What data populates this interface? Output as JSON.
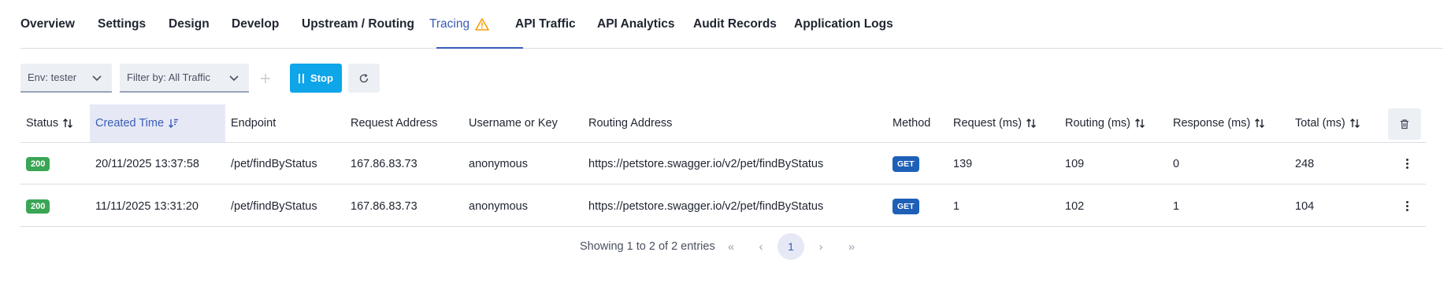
{
  "tabs": [
    {
      "label": "Overview",
      "active": false
    },
    {
      "label": "Settings",
      "active": false
    },
    {
      "label": "Design",
      "active": false
    },
    {
      "label": "Develop",
      "active": false
    },
    {
      "label": "Upstream / Routing",
      "active": false
    },
    {
      "label": "Tracing",
      "active": true,
      "icon": "warning-icon"
    },
    {
      "label": "API Traffic",
      "active": false
    },
    {
      "label": "API Analytics",
      "active": false
    },
    {
      "label": "Audit Records",
      "active": false
    },
    {
      "label": "Application Logs",
      "active": false
    }
  ],
  "toolbar": {
    "env_label": "Env: tester",
    "filter_label": "Filter by: All Traffic",
    "stop_label": "Stop",
    "add_icon": "plus-icon",
    "refresh_icon": "refresh-icon"
  },
  "table": {
    "columns": [
      "Status",
      "Created Time",
      "Endpoint",
      "Request Address",
      "Username or Key",
      "Routing Address",
      "Method",
      "Request (ms)",
      "Routing (ms)",
      "Response (ms)",
      "Total (ms)"
    ],
    "sorted_column": "Created Time",
    "rows": [
      {
        "status": "200",
        "created_time": "20/11/2025 13:37:58",
        "endpoint": "/pet/findByStatus",
        "request_address": "167.86.83.73",
        "username": "anonymous",
        "routing_address": "https://petstore.swagger.io/v2/pet/findByStatus",
        "method": "GET",
        "request_ms": "139",
        "routing_ms": "109",
        "response_ms": "0",
        "total_ms": "248"
      },
      {
        "status": "200",
        "created_time": "11/11/2025 13:31:20",
        "endpoint": "/pet/findByStatus",
        "request_address": "167.86.83.73",
        "username": "anonymous",
        "routing_address": "https://petstore.swagger.io/v2/pet/findByStatus",
        "method": "GET",
        "request_ms": "1",
        "routing_ms": "102",
        "response_ms": "1",
        "total_ms": "104"
      }
    ]
  },
  "pagination": {
    "summary": "Showing 1 to 2 of 2 entries",
    "current_page": "1",
    "first": "«",
    "prev": "‹",
    "next": "›",
    "last": "»"
  },
  "colors": {
    "accent": "#3a5bb7",
    "stop_button": "#0ea5e9",
    "status_ok": "#3aa655",
    "method_get": "#1e5fb8",
    "warning": "#f59e0b"
  }
}
